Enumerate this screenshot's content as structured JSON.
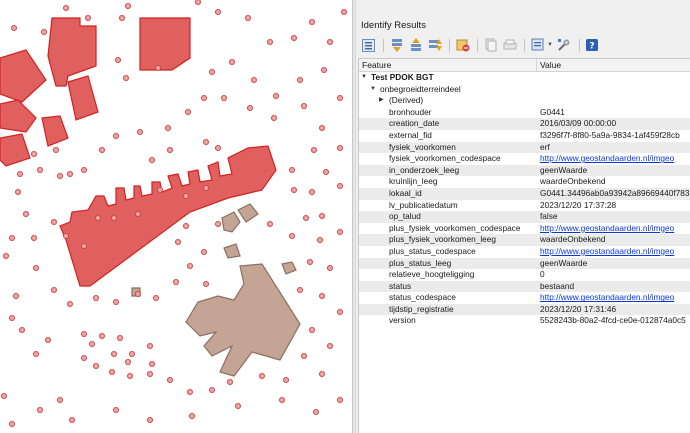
{
  "panel": {
    "title": "Identify Results",
    "toolbar": {
      "icons": [
        "expand-icon",
        "collapse-icon",
        "expand-new-icon",
        "expand-all-icon",
        "clear-results-icon",
        "copy-feature-icon",
        "print-icon",
        "identify-mode-icon",
        "settings-icon",
        "help-icon"
      ]
    },
    "columns": {
      "feature": "Feature",
      "value": "Value"
    },
    "layer": {
      "name": "Test PDOK BGT"
    },
    "feature": {
      "name": "onbegroeidterreindeel"
    },
    "derived": {
      "label": "(Derived)"
    },
    "attributes": [
      {
        "name": "bronhouder",
        "value": "G0441",
        "link": false
      },
      {
        "name": "creation_date",
        "value": "2016/03/09 00:00:00",
        "link": false
      },
      {
        "name": "external_fid",
        "value": "f3296f7f-8f80-5a9a-9834-1af459f28cb",
        "link": false
      },
      {
        "name": "fysiek_voorkomen",
        "value": "erf",
        "link": false
      },
      {
        "name": "fysiek_voorkomen_codespace",
        "value": "http://www.geostandaarden.nl/imgeo",
        "link": true
      },
      {
        "name": "in_onderzoek_leeg",
        "value": "geenWaarde",
        "link": false
      },
      {
        "name": "kruinlijn_leeg",
        "value": "waardeOnbekend",
        "link": false
      },
      {
        "name": "lokaal_id",
        "value": "G0441.34496ab0a93942a89669440f783",
        "link": false
      },
      {
        "name": "lv_publicatiedatum",
        "value": "2023/12/20 17:37:28",
        "link": false
      },
      {
        "name": "op_talud",
        "value": "false",
        "link": false
      },
      {
        "name": "plus_fysiek_voorkomen_codespace",
        "value": "http://www.geostandaarden.nl/imgeo",
        "link": true
      },
      {
        "name": "plus_fysiek_voorkomen_leeg",
        "value": "waardeOnbekend",
        "link": false
      },
      {
        "name": "plus_status_codespace",
        "value": "http://www.geostandaarden.nl/imgeo",
        "link": true
      },
      {
        "name": "plus_status_leeg",
        "value": "geenWaarde",
        "link": false
      },
      {
        "name": "relatieve_hoogteligging",
        "value": "0",
        "link": false
      },
      {
        "name": "status",
        "value": "bestaand",
        "link": false
      },
      {
        "name": "status_codespace",
        "value": "http://www.geostandaarden.nl/imgeo",
        "link": true
      },
      {
        "name": "tijdstip_registratie",
        "value": "2023/12/20 17:31:46",
        "link": false
      },
      {
        "name": "version",
        "value": "5528243b-80a2-4fcd-ce0e-012874a0c5",
        "link": false
      }
    ]
  },
  "colors": {
    "building_fill": "#e06060",
    "building_stroke": "#d42020",
    "selected_fill": "#c4a494",
    "selected_stroke": "#8c6f60",
    "point_fill": "#f0a0a0",
    "point_stroke": "#c83c3c",
    "link": "#0b37d6"
  }
}
